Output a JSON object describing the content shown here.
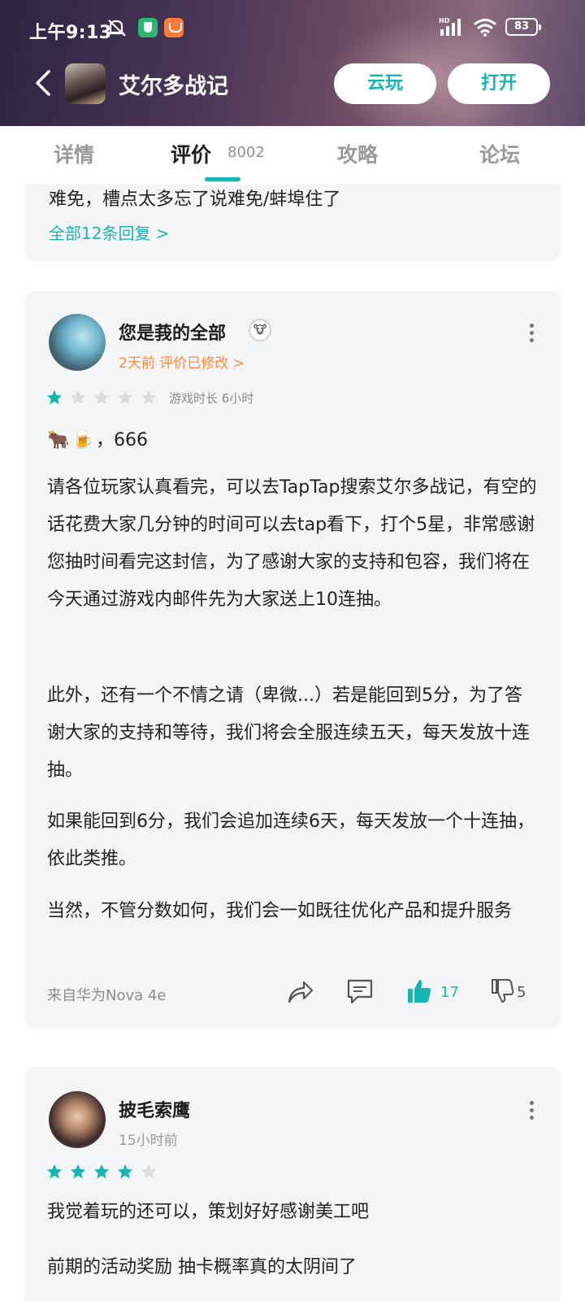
{
  "status_bar": {
    "time": "上午9:13",
    "battery": "83"
  },
  "app_bar": {
    "title": "艾尔多战记",
    "cloud_play": "云玩",
    "open": "打开"
  },
  "tabs": [
    {
      "label": "详情",
      "active": false
    },
    {
      "label": "评价",
      "count": "8002",
      "active": true
    },
    {
      "label": "攻略",
      "active": false
    },
    {
      "label": "论坛",
      "active": false
    }
  ],
  "previous_review": {
    "tail_text": "难免，槽点太多忘了说难免/蚌埠住了",
    "all_replies": "全部12条回复 >"
  },
  "review_1": {
    "username": "您是莪的全部",
    "meta": "2天前 评价已修改 >",
    "rating": 1,
    "playtime": "游戏时长 6小时",
    "emoji_line": "，666",
    "paragraphs": [
      "请各位玩家认真看完，可以去TapTap搜索艾尔多战记，有空的话花费大家几分钟的时间可以去tap看下，打个5星，非常感谢您抽时间看完这封信，为了感谢大家的支持和包容，我们将在今天通过游戏内邮件先为大家送上10连抽。",
      "此外，还有一个不情之请（卑微...）若是能回到5分，为了答谢大家的支持和等待，我们将会全服连续五天，每天发放十连抽。",
      "如果能回到6分，我们会追加连续6天，每天发放一个十连抽，依此类推。",
      "当然，不管分数如何，我们会一如既往优化产品和提升服务"
    ],
    "device": "来自华为Nova 4e",
    "likes": "17",
    "dislikes": "5"
  },
  "review_2": {
    "username": "披毛索鹰",
    "meta": "15小时前",
    "rating": 4,
    "paragraphs": [
      "我觉着玩的还可以，策划好好感谢美工吧",
      "前期的活动奖励 抽卡概率真的太阴间了"
    ]
  },
  "colors": {
    "accent": "#15b5b6",
    "orange_meta": "#ff8a3d",
    "card_bg": "#f4f5f7"
  }
}
